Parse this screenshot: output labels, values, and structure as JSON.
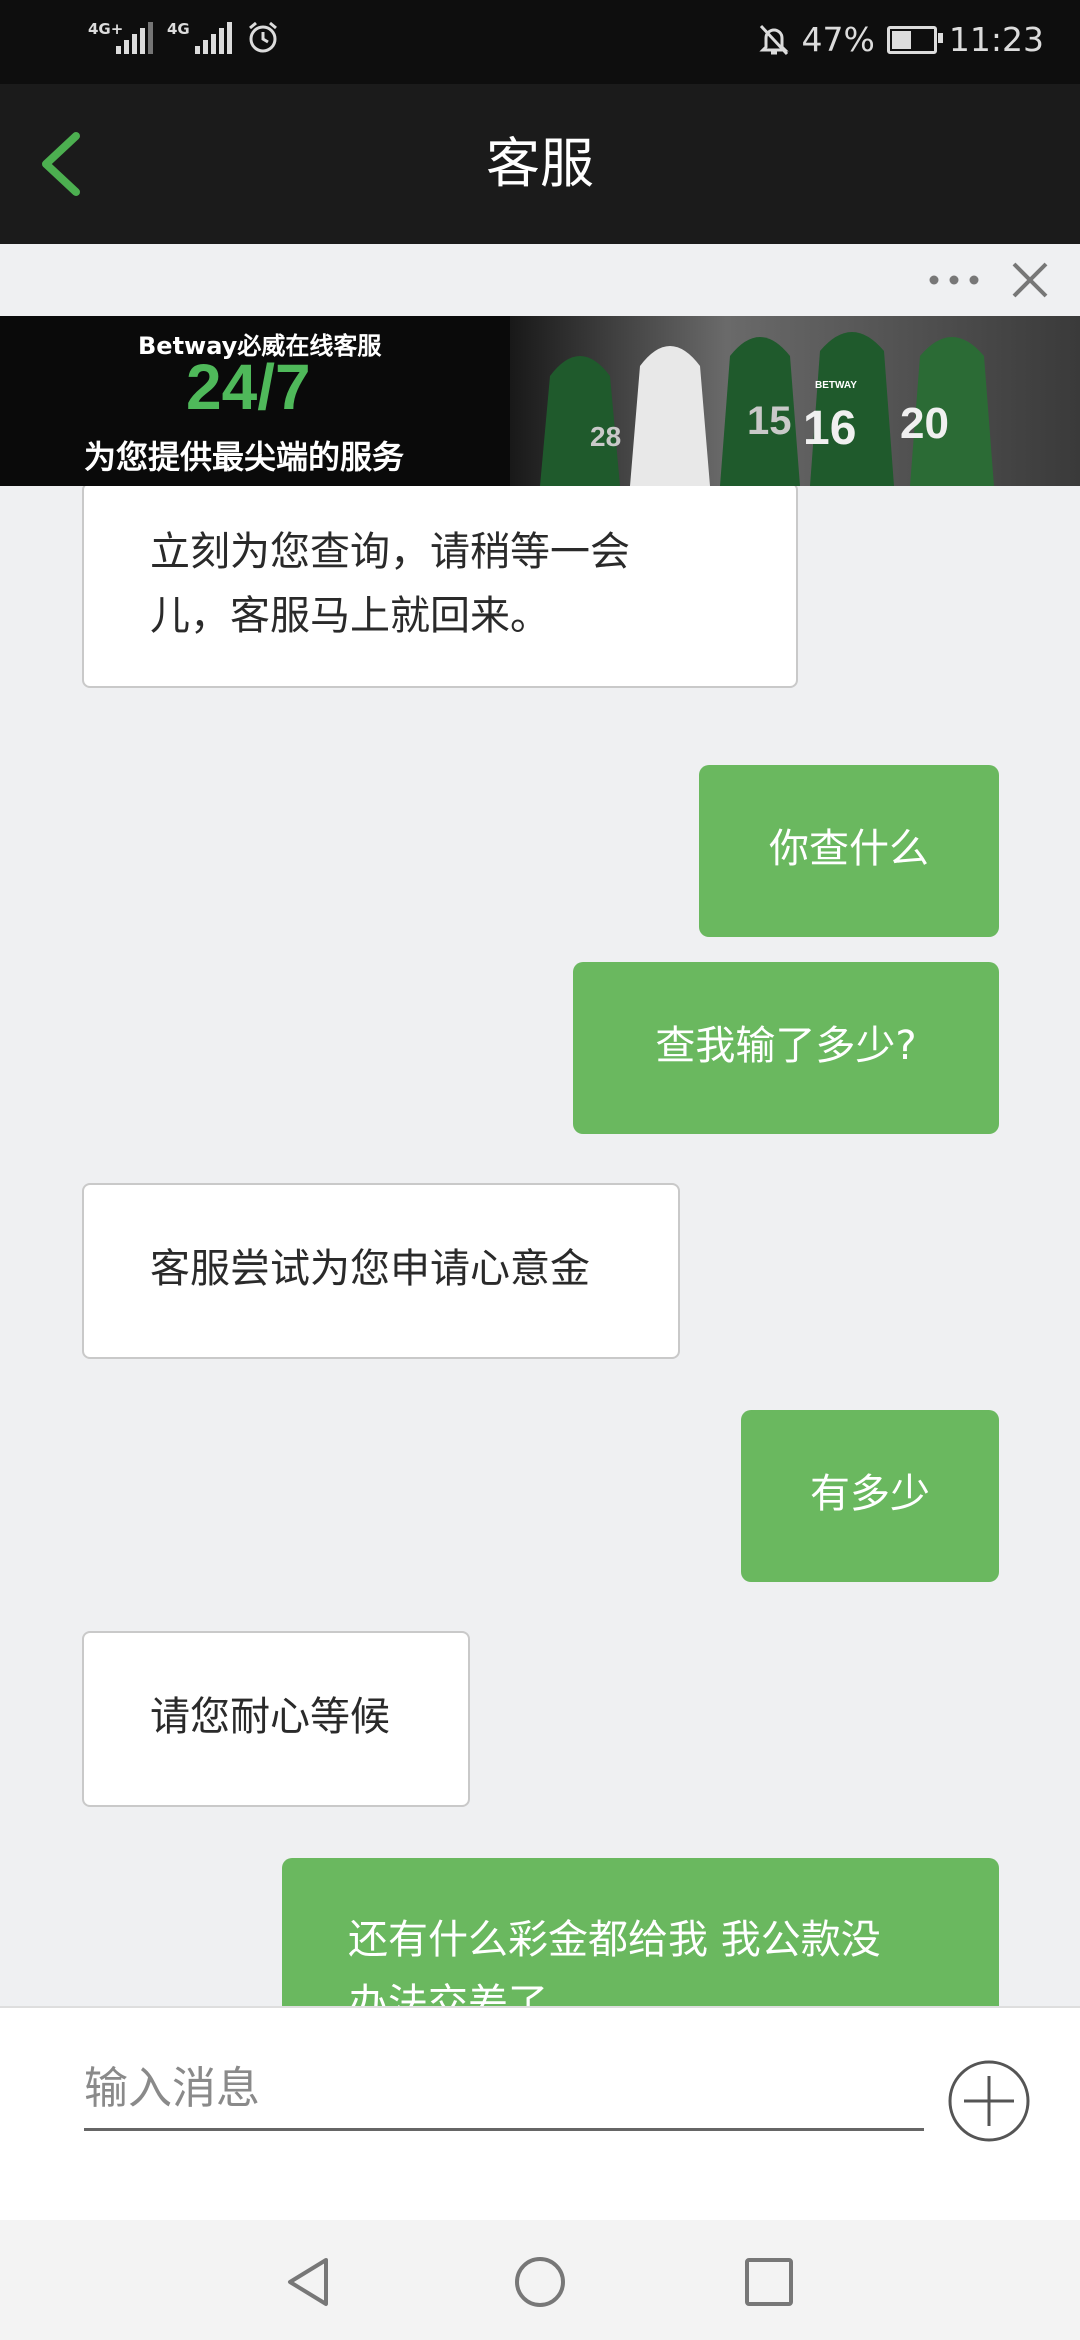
{
  "status_bar": {
    "left_signals": [
      "4G+",
      "4G"
    ],
    "battery_percent": "47%",
    "battery_level": 0.47,
    "time": "11:23",
    "icons": [
      "signal-icon",
      "alarm-icon",
      "mute-notifications-icon",
      "battery-charging-icon"
    ]
  },
  "header": {
    "back_icon": "chevron-left-icon",
    "title": "客服"
  },
  "web_toolbar": {
    "icons": [
      "more-dots-icon",
      "close-icon"
    ]
  },
  "banner": {
    "line1": "Betway必威在线客服",
    "line2": "24/7",
    "line3": "为您提供最尖端的服务",
    "jersey_numbers": [
      "28",
      "15",
      "16",
      "20"
    ],
    "jersey_brand": "BETWAY"
  },
  "messages": [
    {
      "sender": "agent",
      "lines": [
        "立刻为您查询，请稍等一会",
        "儿，客服马上就回来。"
      ]
    },
    {
      "sender": "user",
      "lines": [
        "你查什么"
      ]
    },
    {
      "sender": "user",
      "lines": [
        "查我输了多少?"
      ]
    },
    {
      "sender": "agent",
      "lines": [
        "客服尝试为您申请心意金"
      ]
    },
    {
      "sender": "user",
      "lines": [
        "有多少"
      ]
    },
    {
      "sender": "agent",
      "lines": [
        "请您耐心等候"
      ]
    },
    {
      "sender": "user",
      "lines": [
        "还有什么彩金都给我 我公款没",
        "办法交差了"
      ]
    }
  ],
  "input": {
    "placeholder": "输入消息",
    "value": "",
    "add_icon": "plus-circle-icon"
  },
  "nav_bar": {
    "icons": [
      "back-triangle-icon",
      "home-circle-icon",
      "recents-square-icon"
    ]
  },
  "colors": {
    "status_bar_bg": "#0e0e0e",
    "header_bg": "#1b1b1b",
    "accent_green": "#4caf50",
    "user_bubble": "#6ab85f",
    "agent_bubble": "#ffffff",
    "chat_bg": "#eff0f2"
  }
}
